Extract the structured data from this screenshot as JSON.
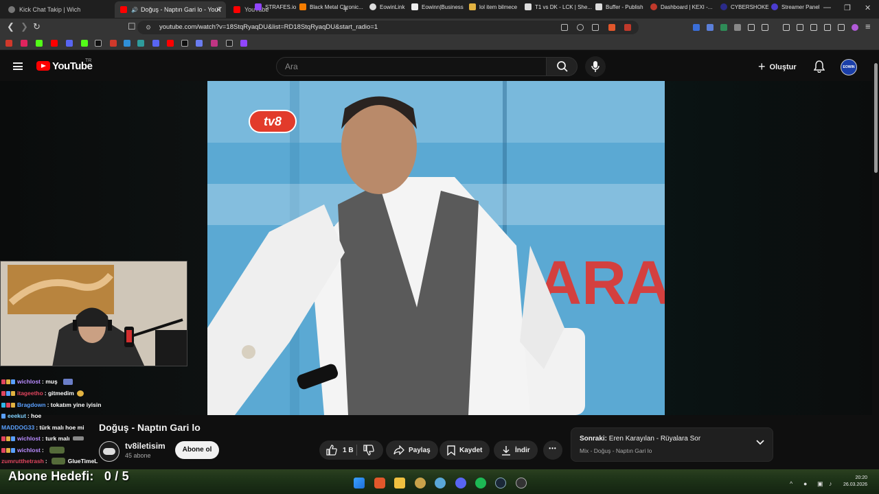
{
  "browser": {
    "tabs": [
      {
        "title": "Kick Chat Takip | Wich"
      },
      {
        "title": "Doğuş - Naptın Gari lo - YouT"
      },
      {
        "title": "YouTube"
      }
    ],
    "url": "youtube.com/watch?v=18StqRyaqDU&list=RD18StqRyaqDU&start_radio=1",
    "bookmarks": [
      "STRAFES.io",
      "Black Metal Chronic...",
      "EowinLink",
      "Eowinn|Business",
      "lol item bilmece",
      "T1 vs DK - LCK | She...",
      "Buffer - Publish",
      "Dashboard | KEXI -...",
      "CYBERSHOKE",
      "Streamer Panel"
    ]
  },
  "youtube": {
    "logo_text": "YouTube",
    "country_code": "TR",
    "search_placeholder": "Ara",
    "create_label": "Oluştur",
    "avatar_text": "EOWIN"
  },
  "video": {
    "title": "Doğuş - Naptın Gari lo",
    "channel": "tv8iletisim",
    "subscribers": "45 abone",
    "subscribe_label": "Abone ol",
    "likes": "1 B",
    "share_label": "Paylaş",
    "save_label": "Kaydet",
    "download_label": "İndir",
    "more_label": "•••",
    "watermark": "tv8"
  },
  "up_next": {
    "prefix": "Sonraki:",
    "title": "Eren Karayılan - Rüyalara Sor",
    "subtitle": "Mix - Doğuş - Naptın Gari lo"
  },
  "stream_overlay": {
    "chat": [
      {
        "user": "wichlost",
        "msg": ": muş",
        "color": "#b98cff"
      },
      {
        "user": "itageetho",
        "msg": ": gitmedim",
        "color": "#e0455e"
      },
      {
        "user": "Bragdown",
        "msg": ": tokatım yine iyisin",
        "color": "#5aa0ff"
      },
      {
        "user": "eeekut",
        "msg": ": hoe",
        "color": "#7fd0ff"
      },
      {
        "user": "MADDOG33",
        "msg": ": türk malı hoe mi",
        "color": "#5aa0ff"
      },
      {
        "user": "wichlost",
        "msg": ": turk malı",
        "color": "#b98cff"
      },
      {
        "user": "wichlost",
        "msg": ":",
        "color": "#b98cff"
      },
      {
        "user": "zumrutthetrash",
        "msg": ":",
        "color": "#e0455e"
      }
    ],
    "emote_text": "GlueTimeL",
    "goal_text": "Abone Hedefi:",
    "goal_value": "0 / 5"
  },
  "taskbar": {
    "time": "20:20",
    "date": "26.03.2026"
  },
  "colors": {
    "youtube_red": "#ff0000",
    "page_bg": "#0f0f0f",
    "chrome_bg": "#353535"
  }
}
